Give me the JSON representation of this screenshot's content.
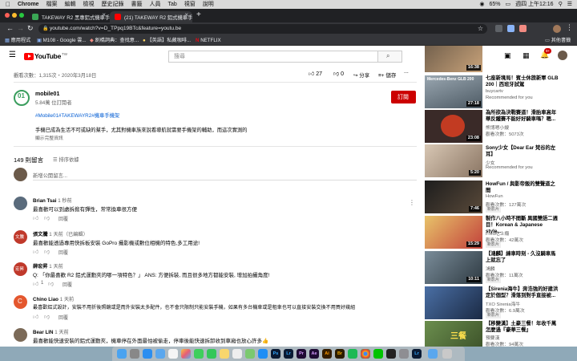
{
  "menubar": {
    "items": [
      "Chrome",
      "檔案",
      "編輯",
      "檢視",
      "歷史記錄",
      "書籤",
      "人員",
      "Tab",
      "視窗",
      "說明"
    ],
    "battery": "65%",
    "clock": "週四 上午12:16"
  },
  "tabs": [
    {
      "title": "TAKEWAY R2 黑專鋁式機車手機",
      "active": false
    },
    {
      "title": "(21) TAKEWAY R2 鋁式機車手機",
      "active": true
    }
  ],
  "new_tab_symbol": "+",
  "address": {
    "url": "youtube.com/watch?v=D_TPpq19BTc&feature=youtu.be"
  },
  "bookmarks": [
    {
      "label": "應用程式"
    },
    {
      "label": "M108 - Google 雲..."
    },
    {
      "label": "劍橋詞典：查找意..."
    },
    {
      "label": "【英語】私藏咖啡..."
    },
    {
      "label": "NETFLIX"
    }
  ],
  "bookmarks_other": "其他書籤",
  "youtube": {
    "logo": "YouTube",
    "logo_region": "TW",
    "search_placeholder": "搜尋",
    "notification_count": "9+"
  },
  "video": {
    "views_date": "觀看次數：1,315次・2020年3月18日",
    "likes": "27",
    "dislikes": "0",
    "share": "分享",
    "save": "儲存",
    "more": "..."
  },
  "channel": {
    "name": "mobile01",
    "subscribers": "5.84萬 位訂閱者",
    "subscribe_label": "訂閱",
    "hashtags": "#Mobile01#TAKEWAYR2#機車手機架",
    "description": "手機已成為生活不可或缺的幫手，尤其對機車族來說看導航就需要手機架的輔助，而這次實測的",
    "show_more": "顯示完整資訊"
  },
  "comments_header": {
    "count": "149 則留言",
    "sort": "排序依據"
  },
  "new_comment_placeholder": "新增公開留言...",
  "comments": [
    {
      "author": "Brian Tsai",
      "time": "1 秒前",
      "text": "最喜歡可以到處拆掀有彈性，常常換車很方便",
      "likes": "",
      "reply": "回覆",
      "avatar_text": "",
      "avatar_color": "#5a6b7c"
    },
    {
      "author": "張文騰",
      "time": "1 天前（已編輯）",
      "text": "最喜歡能透過專用快拆板安裝 GoPro 攝影機或數位相機的特色,多工用途!",
      "likes": "",
      "reply": "回覆",
      "avatar_text": "文騰",
      "avatar_color": "#c0392b"
    },
    {
      "author": "薛宏昇",
      "time": "1 天前",
      "text": "Q: 「你最喜歡 R2 鋁式運動夾的哪一項特色？」 ANS: 方便拆裝, 而且很多地方都能安裝, 增加拍攝角度!",
      "likes": "1",
      "reply": "回覆",
      "avatar_text": "宏昇",
      "avatar_color": "#c0392b"
    },
    {
      "author": "Chino Liao",
      "time": "1 天前",
      "text": "最喜歡鋁式設計，安裝不用折後照鏡或是而外安裝太多配件，也不會只限制只能安裝手機，如果有多台機車或是租車也可以直接安裝交換不用買好幾組",
      "likes": "",
      "reply": "回覆",
      "avatar_text": "C",
      "avatar_color": "#e4572e"
    },
    {
      "author": "Bear LIN",
      "time": "1 天前",
      "text": "最喜歡能快速安裝的鋁式運動夾，機車停在外面最怕被偷走，停車後能快速拆卸收到車廂也放心許多👍",
      "likes": "",
      "reply": "回覆",
      "avatar_text": "",
      "avatar_color": "#7b6a58"
    }
  ],
  "recommendations": [
    {
      "title": "",
      "channel": "",
      "views": "",
      "duration": "16:38"
    },
    {
      "title": "七座新境局！賓士休旅新軍 GLB 200｜西班牙試駕",
      "channel": "buycartv",
      "views": "Recommended for you",
      "duration": "27:18",
      "thumb_text": "Mercedes-Benz GLB 200"
    },
    {
      "title": "為所欲為決戰賽道！滑胎車高年華反鐵賽不能好好騎車嗎？嗯...",
      "channel": "熊博嗯小嫂",
      "views": "觀看次數：5073次",
      "duration": "23:08"
    },
    {
      "title": "Sony少女【Dear Ear 梵谷的左耳】",
      "channel": "少女",
      "views": "Recommended for you",
      "duration": "5:20"
    },
    {
      "title": "HowFun / 與影帝飯的雙聲道之間",
      "channel": "HowFun",
      "views": "觀看次數：127萬次",
      "duration": "7:46",
      "badge": "新影片"
    },
    {
      "title": "製作八小時不間斷 異國雙語二週目！Korean & Japanese style...",
      "channel": "Fred吃上癮",
      "views": "觀看次數：42萬次",
      "duration": "15:29",
      "badge": "新影片"
    },
    {
      "title": "【鴻麟】練車時刻 - 久沒騎車馬上就忘了",
      "channel": "鴻麟",
      "views": "觀看次數：11萬次",
      "duration": "10:11",
      "badge": "新影片"
    },
    {
      "title": "【Sirenia海牛】奔浩強的好建洪定於個型？滑落到對手直接被...",
      "channel": "TXO Sirenia海牛",
      "views": "觀看次數：6.9萬次",
      "duration": "",
      "badge": "新影片"
    },
    {
      "title": "【移變漢】土豪三餐！年收千萬怎麼過『豪華三餐』",
      "channel": "預要漢",
      "views": "觀看次數：94萬次",
      "duration": "",
      "badge": "新影片",
      "thumb_text": "三餐"
    }
  ],
  "colors": {
    "subscribe_bg": "#cc0000",
    "youtube_red": "#ff0000",
    "chrome_dark": "#202124",
    "chrome_tab_active": "#35363a",
    "link_blue": "#065fd4"
  },
  "dock": {
    "labels": [
      "Ps",
      "Lr",
      "Pr",
      "Ae",
      "Ai",
      "Br",
      "Lr"
    ]
  }
}
